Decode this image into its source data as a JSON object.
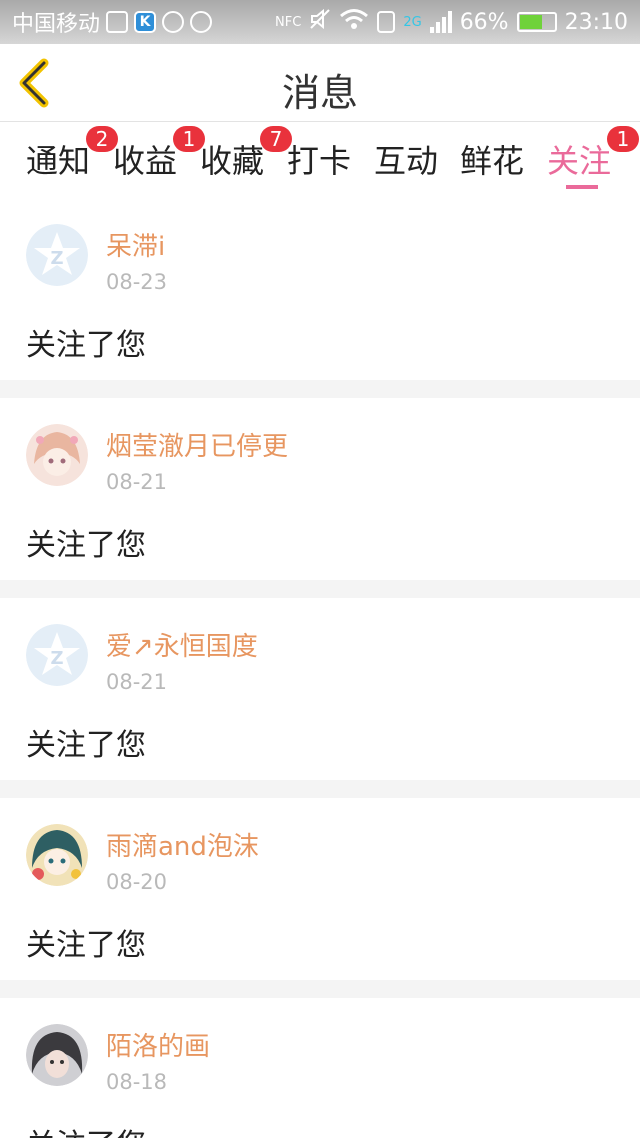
{
  "status_bar": {
    "carrier": "中国移动",
    "k_icon_text": "K",
    "nfc": "NFC",
    "network": "2G",
    "battery": "66%",
    "battery_level": 0.66,
    "time": "23:10"
  },
  "header": {
    "title": "消息",
    "back_icon": "chevron-left-icon"
  },
  "tabs": [
    {
      "label": "通知",
      "badge": "2"
    },
    {
      "label": "收益",
      "badge": "1"
    },
    {
      "label": "收藏",
      "badge": "7"
    },
    {
      "label": "打卡",
      "badge": ""
    },
    {
      "label": "互动",
      "badge": ""
    },
    {
      "label": "鲜花",
      "badge": ""
    },
    {
      "label": "关注",
      "badge": "1",
      "active": true
    }
  ],
  "accent_color": "#ea6a9a",
  "username_color": "#e79660",
  "badge_color": "#e9323c",
  "messages": [
    {
      "name": "呆滞i",
      "date": "08-23",
      "text": "关注了您",
      "avatar": "default-star-avatar"
    },
    {
      "name": "烟莹澈月已停更",
      "date": "08-21",
      "text": "关注了您",
      "avatar": "anime-girl-pink-avatar"
    },
    {
      "name": "爱↗永恒国度",
      "date": "08-21",
      "text": "关注了您",
      "avatar": "default-star-avatar"
    },
    {
      "name": "雨滴and泡沫",
      "date": "08-20",
      "text": "关注了您",
      "avatar": "anime-girl-teal-avatar"
    },
    {
      "name": "陌洛的画",
      "date": "08-18",
      "text": "关注了您",
      "avatar": "photo-portrait-avatar"
    }
  ]
}
